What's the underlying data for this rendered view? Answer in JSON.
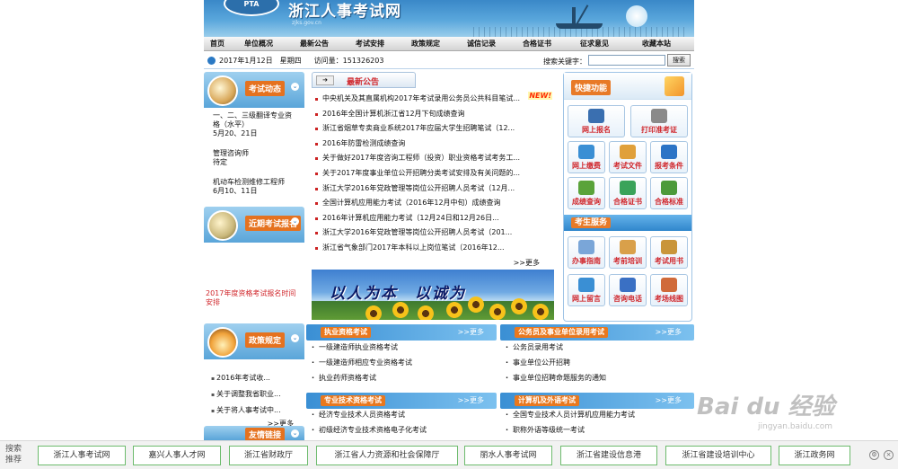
{
  "site": {
    "title": "浙江人事考试网",
    "logo_text": "PTA",
    "tagline": "zjks.gov.cn"
  },
  "nav": [
    "首页",
    "单位概况",
    "最新公告",
    "考试安排",
    "政策规定",
    "诚信记录",
    "合格证书",
    "征求意见",
    "收藏本站"
  ],
  "info": {
    "date": "2017年1月12日",
    "weekday": "星期四",
    "visits_label": "访问量：",
    "visits": "151326203",
    "search_label": "搜索关键字：",
    "search_value": "",
    "search_button": "搜索"
  },
  "exam_news": {
    "title": "考试动态",
    "entries": [
      {
        "name": "一、二、三级翻译专业资格（水平）",
        "date": "5月20、21日"
      },
      {
        "name": "管理咨询师",
        "date": "待定"
      },
      {
        "name": "机动车检测维修工程师",
        "date": "6月10、11日"
      }
    ]
  },
  "recent_signup": {
    "title": "近期考试报名",
    "link": "2017年度资格考试报名时间安排"
  },
  "policy": {
    "title": "政策规定",
    "items": [
      "2016年考试收...",
      "关于调整我省职业...",
      "关于将人事考试中..."
    ],
    "more": ">>更多"
  },
  "friends": {
    "title": "友情链接"
  },
  "announcements": {
    "title": "最新公告",
    "arrow": "➔",
    "new_badge": "NEW!",
    "items": [
      "中央机关及其直属机构2017年考试录用公务员公共科目笔试...",
      "2016年全国计算机浙江省12月下旬成绩查询",
      "浙江省烟草专卖商业系统2017年应届大学生招聘笔试（12...",
      "2016年防雷检测成绩查询",
      "关于做好2017年度咨询工程师（投资）职业资格考试考务工...",
      "关于2017年度事业单位公开招聘分类考试安排及有关问题的...",
      "浙江大学2016年党政管理等岗位公开招聘人员考试（12月...",
      "全国计算机应用能力考试（2016年12月中旬）成绩查询",
      "2016年计算机应用能力考试（12月24日和12月26日...",
      "浙江大学2016年党政管理等岗位公开招聘人员考试（201...",
      "浙江省气象部门2017年本科以上岗位笔试（2016年12..."
    ],
    "more": ">>更多"
  },
  "slogan": "以人为本　以诚为",
  "quick": {
    "title": "快捷功能",
    "wide": [
      {
        "label": "网上报名",
        "icon": "laptop-icon",
        "color": "#3a6fb0"
      },
      {
        "label": "打印准考证",
        "icon": "printer-icon",
        "color": "#8a8a8a"
      }
    ],
    "tiles": [
      {
        "label": "网上缴费",
        "icon": "globe-icon",
        "color": "#3a8fd4"
      },
      {
        "label": "考试文件",
        "icon": "document-icon",
        "color": "#e0a03a"
      },
      {
        "label": "报考条件",
        "icon": "person-icon",
        "color": "#2c74c6"
      },
      {
        "label": "成绩查询",
        "icon": "chart-icon",
        "color": "#5aa33a"
      },
      {
        "label": "合格证书",
        "icon": "certificate-icon",
        "color": "#3aa35a"
      },
      {
        "label": "合格标准",
        "icon": "pen-icon",
        "color": "#4c9a3a"
      }
    ]
  },
  "service": {
    "title": "考生服务",
    "tiles": [
      {
        "label": "办事指南",
        "icon": "book-icon",
        "color": "#7aa6d8"
      },
      {
        "label": "考前培训",
        "icon": "box-icon",
        "color": "#d9a04a"
      },
      {
        "label": "考试用书",
        "icon": "books-icon",
        "color": "#c9953a"
      },
      {
        "label": "网上留言",
        "icon": "chat-icon",
        "color": "#3a8fd4"
      },
      {
        "label": "咨询电话",
        "icon": "shield-icon",
        "color": "#3a70c4"
      },
      {
        "label": "考场线图",
        "icon": "map-icon",
        "color": "#d06a3a"
      }
    ]
  },
  "sections": {
    "practice": {
      "title": "执业资格考试",
      "more": ">>更多",
      "items": [
        "一级建造师执业资格考试",
        "一级建造师相应专业资格考试",
        "执业药师资格考试"
      ]
    },
    "civil": {
      "title": "公务员及事业单位录用考试",
      "more": ">>更多",
      "items": [
        "公务员录用考试",
        "事业单位公开招聘",
        "事业单位招聘命题服务的通知"
      ]
    },
    "tech": {
      "title": "专业技术资格考试",
      "more": ">>更多",
      "items": [
        "经济专业技术人员资格考试",
        "初级经济专业技术资格电子化考试"
      ]
    },
    "computer": {
      "title": "计算机及外语考试",
      "more": ">>更多",
      "items": [
        "全国专业技术人员计算机应用能力考试",
        "职称外语等级统一考试"
      ]
    }
  },
  "watermark": {
    "brand": "Bai du 经验",
    "url": "jingyan.baidu.com"
  },
  "bottom_bar": {
    "label": "搜索推荐",
    "links": [
      "浙江人事考试网",
      "嘉兴人事人才网",
      "浙江省财政厅",
      "浙江省人力资源和社会保障厅",
      "丽水人事考试网",
      "浙江省建设信息港",
      "浙江省建设培训中心",
      "浙江政务网"
    ],
    "settings_icon": "gear-icon",
    "close_icon": "close-icon"
  }
}
